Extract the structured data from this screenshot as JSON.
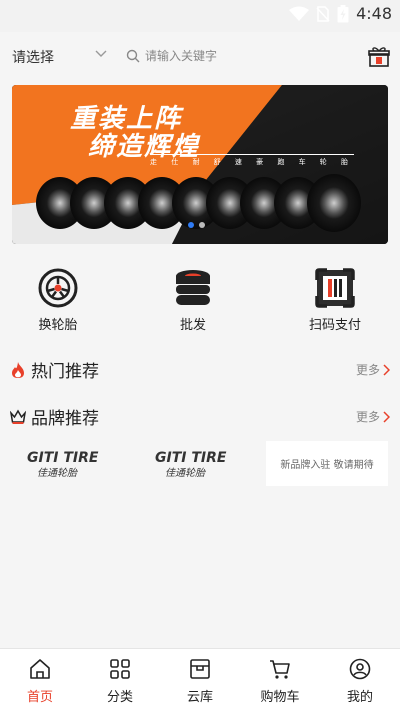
{
  "status_bar": {
    "time": "4:48"
  },
  "header": {
    "region_placeholder": "请选择",
    "search_placeholder": "请输入关键字"
  },
  "banner": {
    "headline_line1": "重装上阵",
    "headline_line2": "缔造辉煌",
    "subline": "走 仕 耐 舒 速 豪 跑 车 轮 胎",
    "slide_count": 2,
    "active_slide": 1
  },
  "quick_actions": [
    {
      "label": "换轮胎",
      "icon": "wheel-icon"
    },
    {
      "label": "批发",
      "icon": "tire-stack-icon"
    },
    {
      "label": "扫码支付",
      "icon": "scan-pay-icon"
    }
  ],
  "sections": {
    "hot": {
      "title": "热门推荐",
      "more": "更多",
      "icon": "flame-icon"
    },
    "brand": {
      "title": "品牌推荐",
      "more": "更多",
      "icon": "crown-icon"
    }
  },
  "brands": [
    {
      "logo_text": "GITI TIRE",
      "logo_cn": "佳通轮胎"
    },
    {
      "logo_text": "GITI TIRE",
      "logo_cn": "佳通轮胎"
    },
    {
      "coming_soon": "新品牌入驻 敬请期待"
    }
  ],
  "tabbar": {
    "items": [
      {
        "label": "首页",
        "icon": "home-icon",
        "active": true
      },
      {
        "label": "分类",
        "icon": "grid-icon",
        "active": false
      },
      {
        "label": "云库",
        "icon": "warehouse-icon",
        "active": false
      },
      {
        "label": "购物车",
        "icon": "cart-icon",
        "active": false
      },
      {
        "label": "我的",
        "icon": "user-icon",
        "active": false
      }
    ]
  },
  "colors": {
    "accent": "#e8402a",
    "banner_orange": "#f2741f",
    "dot_active": "#2f7cf6"
  }
}
